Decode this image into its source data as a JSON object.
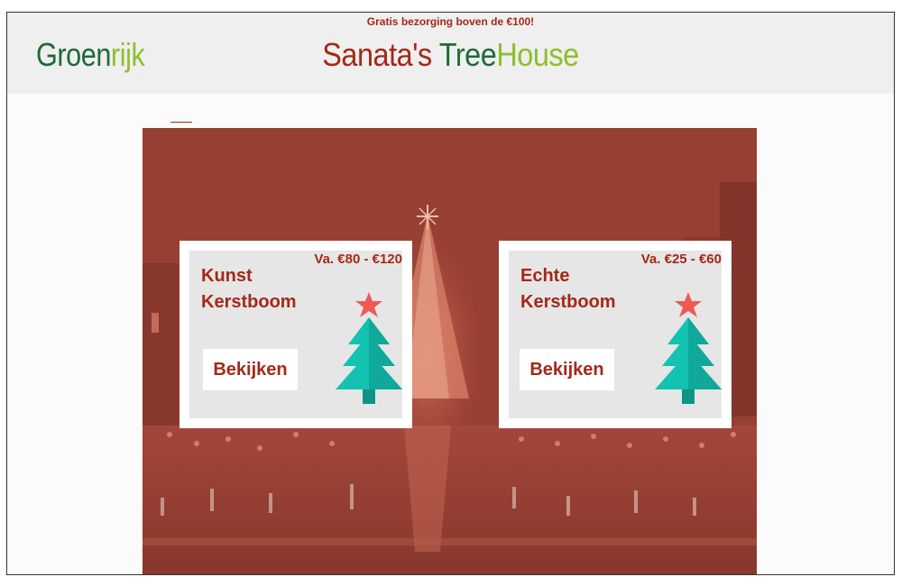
{
  "promo": "Gratis bezorging boven de €100!",
  "logo": {
    "part1": "Groen",
    "part2": "rijk"
  },
  "title": {
    "part1": "Sanata's ",
    "part2": "Tree",
    "part3": "House"
  },
  "colors": {
    "brand_red": "#a52818",
    "brand_green": "#1f6a34",
    "brand_lime": "#8dbf2c",
    "hero_overlay": "#963f33",
    "tree_teal": "#14c2b2",
    "star": "#ef5a54"
  },
  "cards": [
    {
      "price": "Va. €80 - €120",
      "name_line1": "Kunst",
      "name_line2": "Kerstboom",
      "button": "Bekijken",
      "icon": "christmas-tree-icon"
    },
    {
      "price": "Va. €25 - €60",
      "name_line1": "Echte",
      "name_line2": "Kerstboom",
      "button": "Bekijken",
      "icon": "christmas-tree-icon"
    }
  ]
}
